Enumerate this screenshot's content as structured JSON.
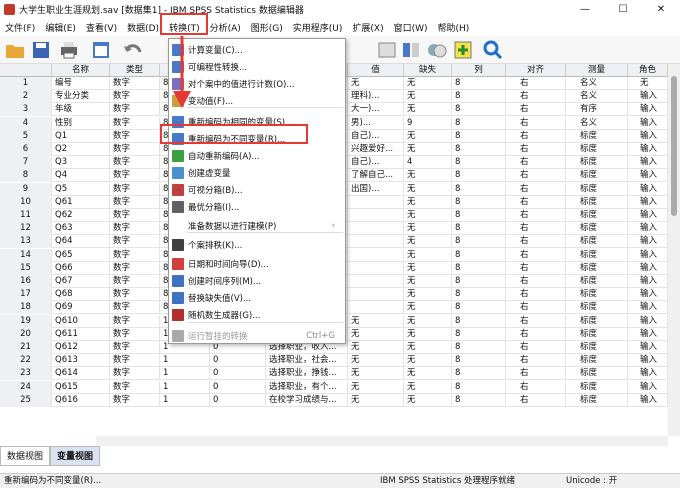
{
  "window": {
    "title": "大学生职业生涯规划.sav [数据集1] - IBM SPSS Statistics 数据编辑器",
    "minimize": "—",
    "maximize": "☐",
    "close": "✕"
  },
  "menu": [
    "文件(F)",
    "编辑(E)",
    "查看(V)",
    "数据(D)",
    "转换(T)",
    "分析(A)",
    "图形(G)",
    "实用程序(U)",
    "扩展(X)",
    "窗口(W)",
    "帮助(H)"
  ],
  "columns": [
    "名称",
    "类型",
    "宽度",
    "小数位数",
    "标签",
    "值",
    "缺失",
    "列",
    "对齐",
    "测量",
    "角色"
  ],
  "rows": [
    [
      "1",
      "编号",
      "数字",
      "8",
      "0",
      "",
      "无",
      "无",
      "8",
      "右",
      "名义",
      "无"
    ],
    [
      "2",
      "专业分类",
      "数字",
      "8",
      "0",
      "",
      "理科)...",
      "无",
      "8",
      "右",
      "名义",
      "输入"
    ],
    [
      "3",
      "年级",
      "数字",
      "8",
      "0",
      "",
      "大一)...",
      "无",
      "8",
      "右",
      "有序",
      "输入"
    ],
    [
      "4",
      "性别",
      "数字",
      "8",
      "0",
      "",
      "男)...",
      "9",
      "8",
      "右",
      "名义",
      "输入"
    ],
    [
      "5",
      "Q1",
      "数字",
      "8",
      "0",
      "",
      "自己)...",
      "无",
      "8",
      "右",
      "标度",
      "输入"
    ],
    [
      "6",
      "Q2",
      "数字",
      "8",
      "0",
      "",
      "兴趣爱好...",
      "无",
      "8",
      "右",
      "标度",
      "输入"
    ],
    [
      "7",
      "Q3",
      "数字",
      "8",
      "0",
      "",
      "自己)...",
      "4",
      "8",
      "右",
      "标度",
      "输入"
    ],
    [
      "8",
      "Q4",
      "数字",
      "8",
      "0",
      "",
      "了解自己...",
      "无",
      "8",
      "右",
      "标度",
      "输入"
    ],
    [
      "9",
      "Q5",
      "数字",
      "8",
      "0",
      "",
      "出国)...",
      "无",
      "8",
      "右",
      "标度",
      "输入"
    ],
    [
      "10",
      "Q61",
      "数字",
      "8",
      "0",
      "",
      "",
      "无",
      "8",
      "右",
      "标度",
      "输入"
    ],
    [
      "11",
      "Q62",
      "数字",
      "8",
      "0",
      "",
      "",
      "无",
      "8",
      "右",
      "标度",
      "输入"
    ],
    [
      "12",
      "Q63",
      "数字",
      "8",
      "0",
      "",
      "",
      "无",
      "8",
      "右",
      "标度",
      "输入"
    ],
    [
      "13",
      "Q64",
      "数字",
      "8",
      "0",
      "",
      "",
      "无",
      "8",
      "右",
      "标度",
      "输入"
    ],
    [
      "14",
      "Q65",
      "数字",
      "8",
      "0",
      "",
      "",
      "无",
      "8",
      "右",
      "标度",
      "输入"
    ],
    [
      "15",
      "Q66",
      "数字",
      "8",
      "0",
      "",
      "",
      "无",
      "8",
      "右",
      "标度",
      "输入"
    ],
    [
      "16",
      "Q67",
      "数字",
      "8",
      "0",
      "",
      "",
      "无",
      "8",
      "右",
      "标度",
      "输入"
    ],
    [
      "17",
      "Q68",
      "数字",
      "8",
      "0",
      "",
      "",
      "无",
      "8",
      "右",
      "标度",
      "输入"
    ],
    [
      "18",
      "Q69",
      "数字",
      "8",
      "0",
      "",
      "",
      "无",
      "8",
      "右",
      "标度",
      "输入"
    ],
    [
      "19",
      "Q610",
      "数字",
      "1",
      "0",
      "对现在专业的满意...",
      "无",
      "无",
      "8",
      "右",
      "标度",
      "输入"
    ],
    [
      "20",
      "Q611",
      "数字",
      "1",
      "0",
      "选择职业，与个...",
      "无",
      "无",
      "8",
      "右",
      "标度",
      "输入"
    ],
    [
      "21",
      "Q612",
      "数字",
      "1",
      "0",
      "选择职业，收入...",
      "无",
      "无",
      "8",
      "右",
      "标度",
      "输入"
    ],
    [
      "22",
      "Q613",
      "数字",
      "1",
      "0",
      "选择职业，社会...",
      "无",
      "无",
      "8",
      "右",
      "标度",
      "输入"
    ],
    [
      "23",
      "Q614",
      "数字",
      "1",
      "0",
      "选择职业，挣钱...",
      "无",
      "无",
      "8",
      "右",
      "标度",
      "输入"
    ],
    [
      "24",
      "Q615",
      "数字",
      "1",
      "0",
      "选择职业，有个...",
      "无",
      "无",
      "8",
      "右",
      "标度",
      "输入"
    ],
    [
      "25",
      "Q616",
      "数字",
      "1",
      "0",
      "在校学习成绩与...",
      "无",
      "无",
      "8",
      "右",
      "标度",
      "输入"
    ]
  ],
  "dropdown": [
    {
      "label": "计算变量(C)...",
      "color": "#4a78c8"
    },
    {
      "label": "可编程性转换...",
      "color": "#4a78c8"
    },
    {
      "label": "对个案中的值进行计数(O)...",
      "color": "#7a6fc0"
    },
    {
      "label": "变动值(F)...",
      "color": "#c8a040"
    },
    {
      "label": "重新编码为相同的变量(S)...",
      "color": "#4a78c8"
    },
    {
      "label": "重新编码为不同变量(R)...",
      "color": "#4a78c8"
    },
    {
      "label": "自动重新编码(A)...",
      "color": "#3aa040"
    },
    {
      "label": "创建虚变量",
      "color": "#4a90d0"
    },
    {
      "label": "可视分箱(B)...",
      "color": "#c04040"
    },
    {
      "label": "最优分箱(I)...",
      "color": "#606060"
    },
    {
      "label": "准备数据以进行建模(P)",
      "color": "",
      "arrow": "›"
    },
    {
      "label": "个案排秩(K)...",
      "color": "#404040"
    },
    {
      "label": "日期和时间向导(D)...",
      "color": "#d04040"
    },
    {
      "label": "创建时间序列(M)...",
      "color": "#4070c0"
    },
    {
      "label": "替换缺失值(V)...",
      "color": "#4070c0"
    },
    {
      "label": "随机数生成器(G)...",
      "color": "#b03030"
    },
    {
      "label": "运行暂挂的转换",
      "shortcut": "Ctrl+G",
      "color": "#aaaaaa",
      "disabled": true
    }
  ],
  "tabs": [
    "数据视图",
    "变量视图"
  ],
  "status": {
    "left": "重新编码为不同变量(R)...",
    "middle": "IBM SPSS Statistics 处理程序就绪",
    "right": "Unicode : 开"
  }
}
